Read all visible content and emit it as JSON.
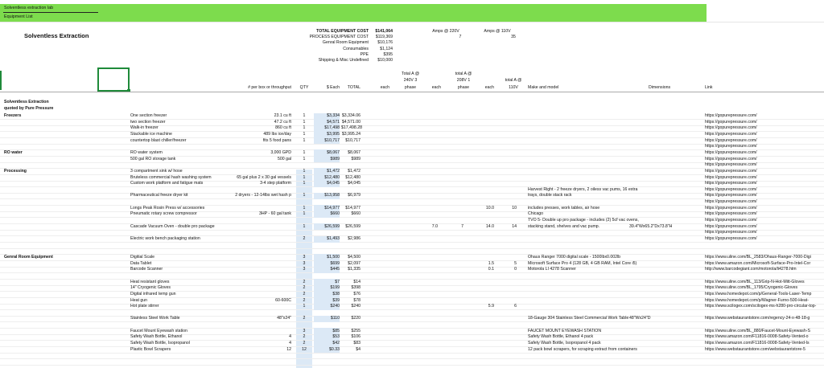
{
  "banner": {
    "line1": "Solventless extraction lab",
    "line2": "Equipment List"
  },
  "title": "Solventless Extraction",
  "summary": [
    {
      "label": "TOTAL EQUIPMENT COST",
      "value": "$141,064",
      "bold": true
    },
    {
      "label": "PROCESS EQUIPMENT COST",
      "value": "$119,369"
    },
    {
      "label": "Genral Room Equipment",
      "value": "$10,176"
    },
    {
      "label": "Consumables",
      "value": "$1,124"
    },
    {
      "label": "PPE",
      "value": "$395"
    },
    {
      "label": "Shipping & Misc Undefined",
      "value": "$10,000"
    }
  ],
  "amps": {
    "a220_label": "Amps  @ 220V",
    "a110_label": "Amps  @ 110V",
    "a220_val": "7",
    "a110_val": "35"
  },
  "headers": {
    "per_box": "# per box or throughput",
    "qty": "QTY",
    "each": "$ Each",
    "total": "TOTAL",
    "each2": "each",
    "ta240": [
      "Total A @",
      "240V 3",
      "phase"
    ],
    "each3": "each",
    "ta208": [
      "total A @",
      "208V 1",
      "phase"
    ],
    "each4": "each",
    "ta110": [
      "total  A @",
      "110V"
    ],
    "make": "Make and model",
    "dims": "Dimensions",
    "link": "Link"
  },
  "section": {
    "title": "Solventless Extraction",
    "subtitle": "quoted by Pure Pressure"
  },
  "groups": [
    {
      "name": "Freezers",
      "row": 0
    },
    {
      "name": "RO water",
      "row": 6
    },
    {
      "name": "Processing",
      "row": 9
    },
    {
      "name": "Genral Room Equipment",
      "row": 23
    }
  ],
  "rows": [
    {
      "r": 0,
      "item": "One section freezer",
      "spec": "23.1 cu ft",
      "qty": "1",
      "each": "$3,334",
      "total": "$3,334.06",
      "link": "https://gopurepressure.com/"
    },
    {
      "r": 1,
      "item": "two section freezer",
      "spec": "47.2 cu ft",
      "qty": "1",
      "each": "$4,571",
      "total": "$4,571.00",
      "link": "https://gopurepressure.com/"
    },
    {
      "r": 2,
      "item": "Walk-in freezer",
      "spec": "860 cu ft",
      "qty": "1",
      "each": "$17,498",
      "total": "$17,498.28",
      "link": "https://gopurepressure.com/"
    },
    {
      "r": 3,
      "item": "Stackable ice machine",
      "spec": "489 lbs ice/day",
      "qty": "1",
      "each": "$3,995",
      "total": "$3,995.24",
      "link": "https://gopurepressure.com/"
    },
    {
      "r": 4,
      "item": "countertop blast chiller/freezer",
      "spec": "fits 5 food pans",
      "qty": "1",
      "each": "$10,717",
      "total": "$10,717",
      "link": "https://gopurepressure.com/"
    },
    {
      "r": 5,
      "link": "https://gopurepressure.com/"
    },
    {
      "r": 6,
      "item": "RO water system",
      "spec": "3,000 GPD",
      "qty": "1",
      "each": "$8,067",
      "total": "$8,067",
      "link": "https://gopurepressure.com/"
    },
    {
      "r": 7,
      "item": "500 gal RO storage tank",
      "spec": "500 gal",
      "qty": "1",
      "each": "$989",
      "total": "$989",
      "link": "https://gopurepressure.com/"
    },
    {
      "r": 8,
      "link": "https://gopurepressure.com/"
    },
    {
      "r": 9,
      "item": "3 compartment sink w/ hose",
      "qty": "1",
      "each": "$1,472",
      "total": "$1,472",
      "link": "https://gopurepressure.com/"
    },
    {
      "r": 10,
      "item": "Bruteless commercial hash washing system",
      "spec": "65 gal plus 2 x 30 gal vessels",
      "qty": "1",
      "each": "$12,480",
      "total": "$12,480",
      "link": "https://gopurepressure.com/"
    },
    {
      "r": 11,
      "item": "Custom work platform and fatigue mats",
      "spec": "3-4 step platform",
      "qty": "1",
      "each": "$4,045",
      "total": "$4,045",
      "link": "https://gopurepressure.com/"
    },
    {
      "r": 12,
      "make": "Harvest Right - 2 freeze dryers, 2 oiless vac pums, 16 extra",
      "link": "https://gopurepressure.com/"
    },
    {
      "r": 13,
      "item": "Pharmaceutical freeze dryer kit",
      "spec": "2 dryers - 12-14lbs wet hash p",
      "qty": "1",
      "each": "$13,958",
      "total": "$6,979",
      "make": "trays, double stack rack",
      "link": "https://gopurepressure.com/"
    },
    {
      "r": 14,
      "link": "https://gopurepressure.com/"
    },
    {
      "r": 15,
      "item": "Longs Peak Rosin Press w/ accessories",
      "qty": "1",
      "each": "$14,977",
      "total": "$14,977",
      "ta208": "10.0",
      "ta110": "10",
      "make": "includes presses, work tables, air hose",
      "link": "https://gopurepressure.com/"
    },
    {
      "r": 16,
      "item": "Pneumatic rotary screw compressor",
      "spec": "3HP - 60 gal tank",
      "qty": "1",
      "each": "$660",
      "total": "$660",
      "make": "Chicago",
      "link": "https://gopurepressure.com/"
    },
    {
      "r": 17,
      "make": "TVO 5- Double up pro package - includes (2) 5cf vac ovens,",
      "link": "https://gopurepressure.com/"
    },
    {
      "r": 18,
      "item": "Cascade Vacuum Oven - double pro package",
      "qty": "1",
      "each": "$26,599",
      "total": "$26,599",
      "ta240": "7.0",
      "each3": "7",
      "ta208": "14.0",
      "ta110": "14",
      "make": "stacking stand, shelves and vac pump.",
      "dims": "39.4\"Wx65.2\"Dx73.8\"H",
      "link": "https://gopurepressure.com/"
    },
    {
      "r": 19,
      "link": "https://gopurepressure.com/"
    },
    {
      "r": 20,
      "item": "Electric work bench packaging station",
      "qty": "2",
      "each": "$1,493",
      "total": "$2,986",
      "link": "https://gopurepressure.com/"
    },
    {
      "r": 23,
      "item": "Digitial Scale",
      "qty": "3",
      "each": "$1,500",
      "total": "$4,500",
      "make": "Ohaus Ranger 7000 digital scale - 1500lbx0.002lb",
      "link": "https://www.uline.com/BL_2583/Ohaus-Ranger-7000-Digi"
    },
    {
      "r": 24,
      "item": "Data Tablet",
      "qty": "3",
      "each": "$699",
      "total": "$2,097",
      "ta208": "1.5",
      "ta110": "5",
      "make": "Microsoft Surface Pro 4 (128 GB, 4 GB RAM, Intel Core i5)",
      "link": "https://www.amazon.com/Microsoft-Surface-Pro-Intel-Cor"
    },
    {
      "r": 25,
      "item": "Barcode Scanner",
      "qty": "3",
      "each": "$445",
      "total": "$1,335",
      "ta208": "0.1",
      "ta110": "0",
      "make": "Motorola LI 4278 Scanner",
      "link": "http://www.barcodegiant.com/motorola/li4278.htm"
    },
    {
      "r": 27,
      "item": "Heat resistant gloves",
      "qty": "2",
      "each": "$7",
      "total": "$14",
      "link": "https://www.uline.com/BL_113/Grip-N-Hot-Mitt-Gloves"
    },
    {
      "r": 28,
      "item": "14\" Cryogenic Gloves",
      "qty": "2",
      "each": "$199",
      "total": "$398",
      "link": "https://www.uline.com/BL_1795/Cryogenic-Gloves"
    },
    {
      "r": 29,
      "item": "Digital infrared temp gun",
      "qty": "2",
      "each": "$38",
      "total": "$76",
      "link": "https://www.homedepot.com/p/General-Tools-Laser-Temp"
    },
    {
      "r": 30,
      "item": "Heat gun",
      "spec": "60-600C",
      "qty": "2",
      "each": "$39",
      "total": "$78",
      "link": "https://www.homedepot.com/p/Wagner-Furno-500-Heat-"
    },
    {
      "r": 31,
      "item": "Hot plate stirrer",
      "qty": "1",
      "each": "$240",
      "total": "$240",
      "ta208": "5.9",
      "ta110": "6",
      "link": "https://www.scilogex.com/scilogex-ms-h280-pro-circular-top-"
    },
    {
      "r": 33,
      "item": "Stainless Steel Work Table",
      "spec": "48\"x24\"",
      "qty": "2",
      "each": "$110",
      "total": "$220",
      "make": "18-Gauge 304 Stainless Steel Commercial Work Table",
      "dims": "48\"Wx24\"D",
      "link": "https://www.webstaurantstore.com/regency-24-x-48-18-g"
    },
    {
      "r": 35,
      "item": "Faucet Mount Eyewash station",
      "qty": "3",
      "each": "$85",
      "total": "$255",
      "make": "FAUCET MOUNT EYEWASH STATION",
      "link": "https://www.uline.com/BL_880/Faucet-Mount-Eyewash-S"
    },
    {
      "r": 36,
      "item": "Safety Wash Bottle, Ethanol",
      "spec": "4",
      "qty": "2",
      "each": "$53",
      "total": "$106",
      "make": "Safety Wash Bottle, Ethanol 4 pack",
      "link": "https://www.amazon.com/F11816-0008-Safety-Vented-o"
    },
    {
      "r": 37,
      "item": "Safety Wash Bottle, Isopropanol",
      "spec": "4",
      "qty": "2",
      "each": "$42",
      "total": "$83",
      "make": "Safety Wash Bottle, Isopropanol 4 pack",
      "link": "https://www.amazon.com/F11816-0008-Safety-Vented-Is"
    },
    {
      "r": 38,
      "item": "Plastic Bowl Scrapers",
      "spec": "12",
      "qty": "12",
      "each": "$0.33",
      "total": "$4",
      "make": "12 pack bowl scrapers, for scraping extract from containers",
      "link": "https://www.webstaurantstore.com/webstaurantstore-5"
    }
  ]
}
